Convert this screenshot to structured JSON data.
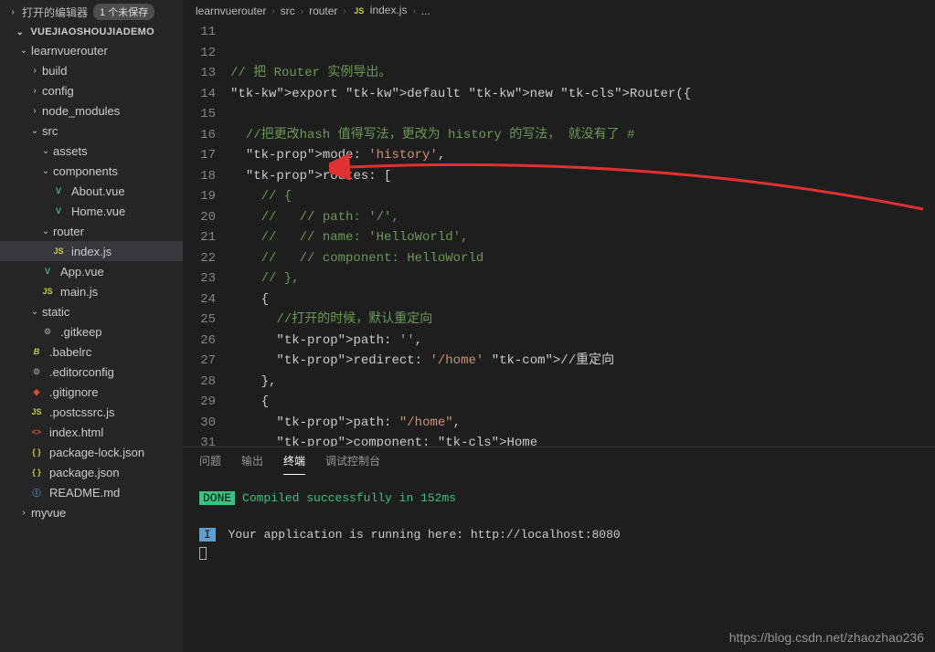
{
  "sidebar": {
    "openEditorsLabel": "打开的编辑器",
    "unsavedBadge": "1 个未保存",
    "rootName": "VUEJIAOSHOUJIADEMO",
    "tree": [
      {
        "type": "folder",
        "name": "learnvuerouter",
        "depth": 0,
        "open": true
      },
      {
        "type": "folder",
        "name": "build",
        "depth": 1,
        "open": false
      },
      {
        "type": "folder",
        "name": "config",
        "depth": 1,
        "open": false
      },
      {
        "type": "folder",
        "name": "node_modules",
        "depth": 1,
        "open": false
      },
      {
        "type": "folder",
        "name": "src",
        "depth": 1,
        "open": true
      },
      {
        "type": "folder",
        "name": "assets",
        "depth": 2,
        "open": true
      },
      {
        "type": "folder",
        "name": "components",
        "depth": 2,
        "open": true
      },
      {
        "type": "file",
        "name": "About.vue",
        "depth": 3,
        "icon": "vue"
      },
      {
        "type": "file",
        "name": "Home.vue",
        "depth": 3,
        "icon": "vue"
      },
      {
        "type": "folder",
        "name": "router",
        "depth": 2,
        "open": true
      },
      {
        "type": "file",
        "name": "index.js",
        "depth": 3,
        "icon": "js",
        "selected": true
      },
      {
        "type": "file",
        "name": "App.vue",
        "depth": 2,
        "icon": "vue"
      },
      {
        "type": "file",
        "name": "main.js",
        "depth": 2,
        "icon": "js"
      },
      {
        "type": "folder",
        "name": "static",
        "depth": 1,
        "open": true
      },
      {
        "type": "file",
        "name": ".gitkeep",
        "depth": 2,
        "icon": "gear"
      },
      {
        "type": "file",
        "name": ".babelrc",
        "depth": 1,
        "icon": "babel"
      },
      {
        "type": "file",
        "name": ".editorconfig",
        "depth": 1,
        "icon": "gear"
      },
      {
        "type": "file",
        "name": ".gitignore",
        "depth": 1,
        "icon": "git"
      },
      {
        "type": "file",
        "name": ".postcssrc.js",
        "depth": 1,
        "icon": "js"
      },
      {
        "type": "file",
        "name": "index.html",
        "depth": 1,
        "icon": "html"
      },
      {
        "type": "file",
        "name": "package-lock.json",
        "depth": 1,
        "icon": "json"
      },
      {
        "type": "file",
        "name": "package.json",
        "depth": 1,
        "icon": "json"
      },
      {
        "type": "file",
        "name": "README.md",
        "depth": 1,
        "icon": "info"
      },
      {
        "type": "folder",
        "name": "myvue",
        "depth": 0,
        "open": false
      }
    ]
  },
  "breadcrumb": {
    "parts": [
      "learnvuerouter",
      "src",
      "router",
      "index.js",
      "..."
    ],
    "fileIconIndex": 3
  },
  "editor": {
    "startLine": 11,
    "lines": [
      "",
      "",
      "// 把 Router 实例导出。",
      "export default new Router({",
      "",
      "  //把更改hash 值得写法，更改为 history 的写法， 就没有了 #",
      "  mode: 'history',",
      "  routes: [",
      "    // {",
      "    //   // path: '/',",
      "    //   // name: 'HelloWorld',",
      "    //   // component: HelloWorld",
      "    // },",
      "    {",
      "      //打开的时候，默认重定向",
      "      path: '',",
      "      redirect: '/home' //重定向",
      "    },",
      "    {",
      "      path: \"/home\",",
      "      component: Home"
    ]
  },
  "panel": {
    "tabs": [
      "问题",
      "输出",
      "终端",
      "调试控制台"
    ],
    "activeTab": 2,
    "doneLabel": "DONE",
    "doneText": "Compiled successfully in 152ms",
    "infoIcon": "I",
    "infoText": "Your application is running here: http://localhost:8080"
  },
  "watermark": "https://blog.csdn.net/zhaozhao236"
}
